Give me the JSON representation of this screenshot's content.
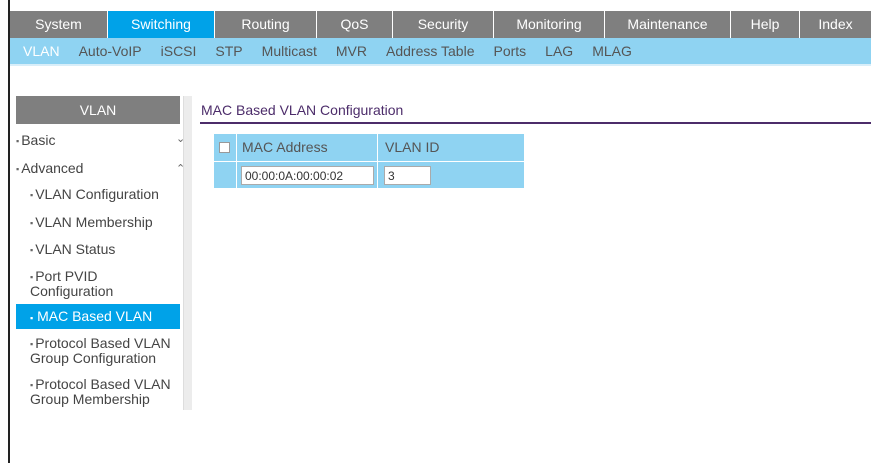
{
  "top_tabs": [
    {
      "label": "System",
      "active": false
    },
    {
      "label": "Switching",
      "active": true
    },
    {
      "label": "Routing",
      "active": false
    },
    {
      "label": "QoS",
      "active": false
    },
    {
      "label": "Security",
      "active": false
    },
    {
      "label": "Monitoring",
      "active": false
    },
    {
      "label": "Maintenance",
      "active": false
    },
    {
      "label": "Help",
      "active": false
    },
    {
      "label": "Index",
      "active": false
    }
  ],
  "sub_tabs": [
    {
      "label": "VLAN",
      "active": true
    },
    {
      "label": "Auto-VoIP",
      "active": false
    },
    {
      "label": "iSCSI",
      "active": false
    },
    {
      "label": "STP",
      "active": false
    },
    {
      "label": "Multicast",
      "active": false
    },
    {
      "label": "MVR",
      "active": false
    },
    {
      "label": "Address Table",
      "active": false
    },
    {
      "label": "Ports",
      "active": false
    },
    {
      "label": "LAG",
      "active": false
    },
    {
      "label": "MLAG",
      "active": false
    }
  ],
  "sidebar": {
    "title": "VLAN",
    "basic": "Basic",
    "advanced": "Advanced",
    "items": {
      "vlan_configuration": "VLAN Configuration",
      "vlan_membership": "VLAN Membership",
      "vlan_status": "VLAN Status",
      "port_pvid_1": "Port PVID",
      "port_pvid_2": "Configuration",
      "mac_based_vlan": "MAC Based VLAN",
      "protocol_group_config_1": "Protocol Based VLAN",
      "protocol_group_config_2": "Group Configuration",
      "protocol_group_member_1": "Protocol Based VLAN",
      "protocol_group_member_2": "Group Membership"
    }
  },
  "content": {
    "title": "MAC Based VLAN Configuration",
    "table": {
      "headers": {
        "mac": "MAC Address",
        "vlan": "VLAN ID"
      },
      "row": {
        "mac": "00:00:0A:00:00:02",
        "vlan": "3"
      }
    }
  },
  "icons": {
    "basic_chevron": "chevron-down-icon",
    "advanced_chevron": "chevron-up-icon",
    "bullet": "bullet-icon"
  },
  "colors": {
    "active_tab": "#00a2e8",
    "tab_bar": "#7f7f7f",
    "sub_bar": "#8fd3f2",
    "title_accent": "#4c2c6a"
  }
}
